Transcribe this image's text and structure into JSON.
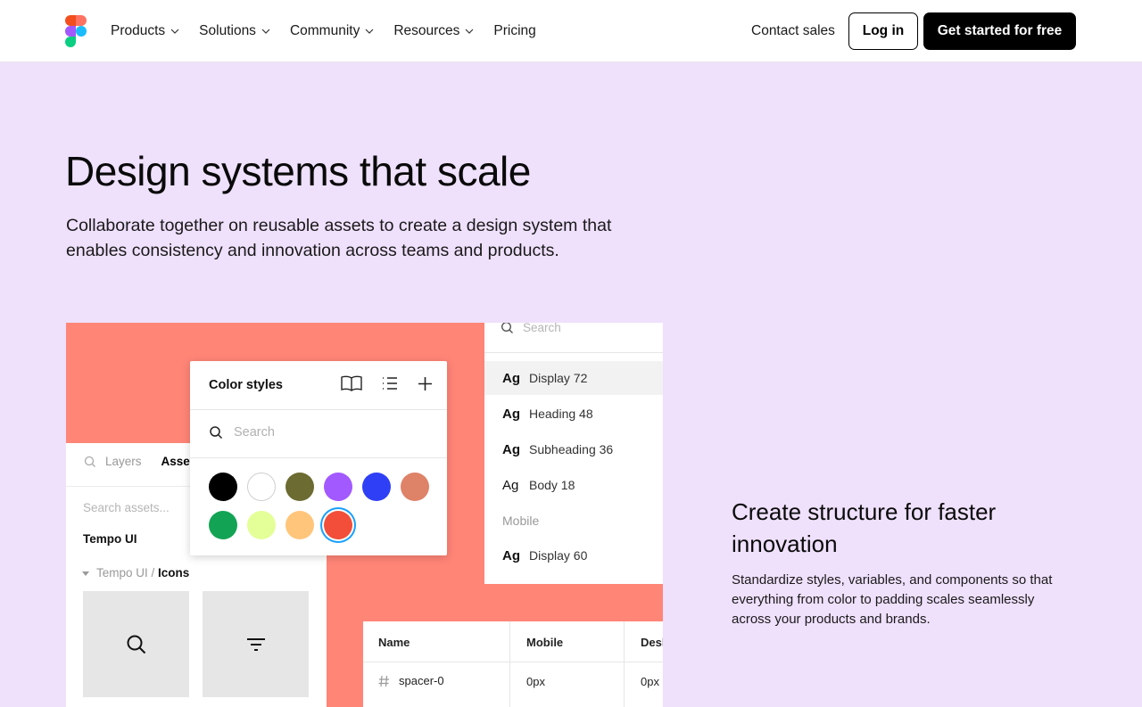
{
  "header": {
    "nav": [
      "Products",
      "Solutions",
      "Community",
      "Resources",
      "Pricing"
    ],
    "contact": "Contact sales",
    "login": "Log in",
    "cta": "Get started for free"
  },
  "hero": {
    "title": "Design systems that scale",
    "subtitle": "Collaborate together on reusable assets to create a design system that enables consistency and innovation across teams and products."
  },
  "illustration": {
    "layers": {
      "tab_layers": "Layers",
      "tab_assets": "Assets",
      "search_placeholder": "Search assets...",
      "library": "Tempo UI",
      "path_prefix": "Tempo UI /",
      "path_current": "Icons",
      "icons": [
        "search-icon",
        "filter-icon"
      ]
    },
    "color_styles": {
      "title": "Color styles",
      "search_placeholder": "Search",
      "swatches": [
        "#000000",
        "#ffffff",
        "#6b6b32",
        "#a259ff",
        "#2f3ff5",
        "#de8268",
        "#12a454",
        "#e4ff97",
        "#ffc57a",
        "#f24e3a"
      ],
      "selected_index": 9
    },
    "type_styles": {
      "search_placeholder": "Search",
      "rows": [
        {
          "ag": "Ag",
          "label": "Display 72"
        },
        {
          "ag": "Ag",
          "label": "Heading 48"
        },
        {
          "ag": "Ag",
          "label": "Subheading 36"
        },
        {
          "ag": "Ag",
          "label": "Body 18"
        }
      ],
      "group": "Mobile",
      "mobile_row": {
        "ag": "Ag",
        "label": "Display 60"
      }
    },
    "table": {
      "headers": [
        "Name",
        "Mobile",
        "Desktop"
      ],
      "row": {
        "name": "spacer-0",
        "mobile": "0px",
        "desktop": "0px"
      }
    }
  },
  "feature": {
    "title": "Create structure for faster innovation",
    "body": "Standardize styles, variables, and components so that everything from color to padding scales seamlessly across your products and brands."
  }
}
